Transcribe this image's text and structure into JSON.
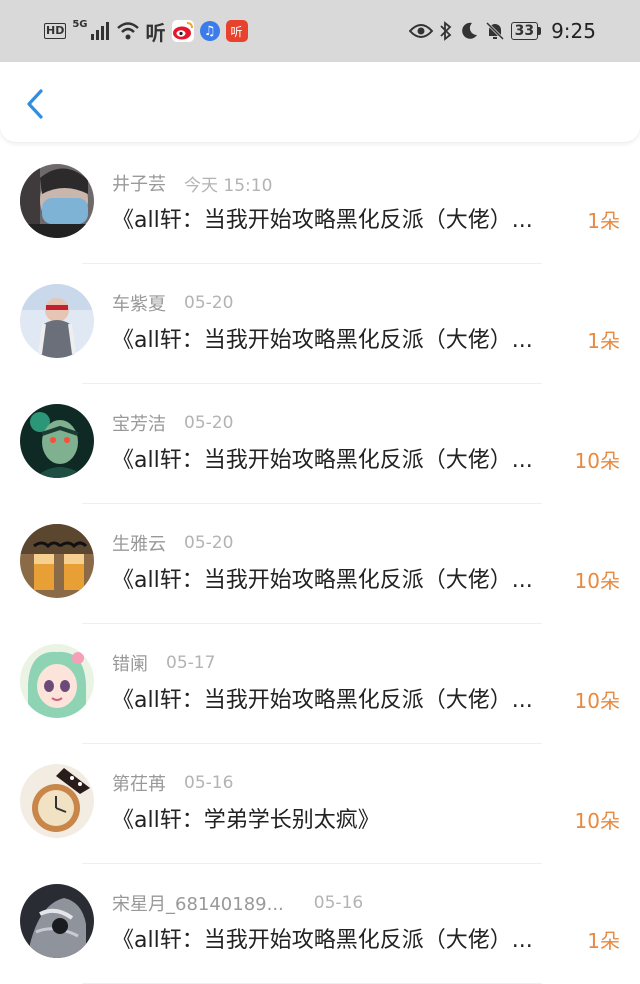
{
  "status_bar": {
    "network_label": "HD",
    "signal_label": "5G",
    "time": "9:25",
    "battery": "33",
    "icons": [
      "hd-icon",
      "signal-icon",
      "wifi-icon",
      "listen-app-icon",
      "weibo-icon",
      "music-icon",
      "listen-red-icon",
      "eye-icon",
      "bluetooth-icon",
      "moon-icon",
      "mute-bell-icon",
      "battery-icon"
    ]
  },
  "nav": {
    "back_icon": "chevron-left-icon"
  },
  "colors": {
    "accent": "#e8893f",
    "back": "#2f8ee0",
    "status_bg": "#d9d9d9"
  },
  "items": [
    {
      "user": "井子芸",
      "time": "今天 15:10",
      "title": "《all轩：当我开始攻略黑化反派（大佬）...",
      "count": "1朵"
    },
    {
      "user": "车紫夏",
      "time": "05-20",
      "title": "《all轩：当我开始攻略黑化反派（大佬）...",
      "count": "1朵"
    },
    {
      "user": "宝芳洁",
      "time": "05-20",
      "title": "《all轩：当我开始攻略黑化反派（大佬）...",
      "count": "10朵"
    },
    {
      "user": "生雅云",
      "time": "05-20",
      "title": "《all轩：当我开始攻略黑化反派（大佬）...",
      "count": "10朵"
    },
    {
      "user": "错阑",
      "time": "05-17",
      "title": "《all轩：当我开始攻略黑化反派（大佬）...",
      "count": "10朵"
    },
    {
      "user": "第茌苒",
      "time": "05-16",
      "title": "《all轩：学弟学长别太疯》",
      "count": "10朵"
    },
    {
      "user": "宋星月_68140189...",
      "time": "05-16",
      "title": "《all轩：当我开始攻略黑化反派（大佬）...",
      "count": "1朵"
    }
  ]
}
